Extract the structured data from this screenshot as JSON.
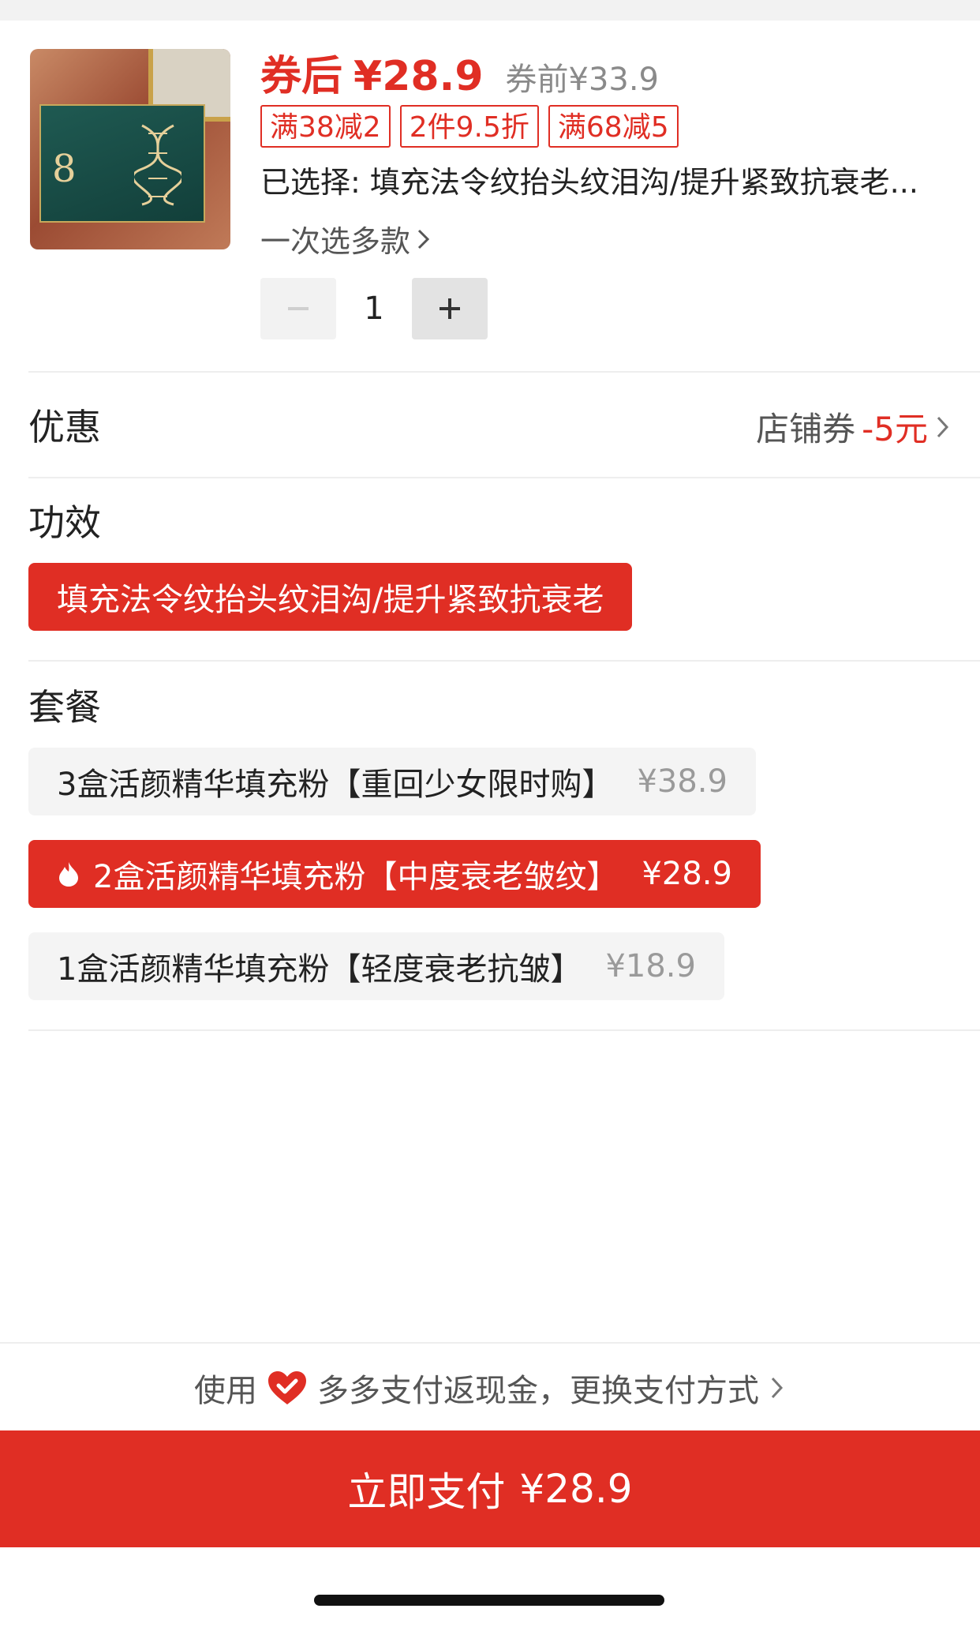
{
  "product": {
    "price_after_label": "券后",
    "price_after": "¥28.9",
    "price_before": "券前¥33.9",
    "promo_tags": [
      "满38减2",
      "2件9.5折",
      "满68减5"
    ],
    "selected_text": "已选择: 填充法令纹抬头纹泪沟/提升紧致抗衰老...",
    "multi_select_label": "一次选多款",
    "quantity": "1"
  },
  "discount": {
    "label": "优惠",
    "prefix": "店铺券",
    "amount": "-5元"
  },
  "effect": {
    "title": "功效",
    "option": "填充法令纹抬头纹泪沟/提升紧致抗衰老"
  },
  "package": {
    "title": "套餐",
    "options": [
      {
        "label": "3盒活颜精华填充粉【重回少女限时购】",
        "price": "¥38.9"
      },
      {
        "label": "2盒活颜精华填充粉【中度衰老皱纹】",
        "price": "¥28.9"
      },
      {
        "label": "1盒活颜精华填充粉【轻度衰老抗皱】",
        "price": "¥18.9"
      }
    ]
  },
  "footer": {
    "pay_note_prefix": "使用",
    "pay_note_text": "多多支付返现金，更换支付方式",
    "pay_button_label": "立即支付",
    "pay_button_price": "¥28.9"
  },
  "colors": {
    "accent": "#e02e24",
    "muted_text": "#8a8a8a",
    "chip_bg": "#f4f4f4"
  },
  "icons": [
    "chevron-right-icon",
    "flame-icon",
    "heart-badge-icon",
    "minus-icon",
    "plus-icon"
  ]
}
